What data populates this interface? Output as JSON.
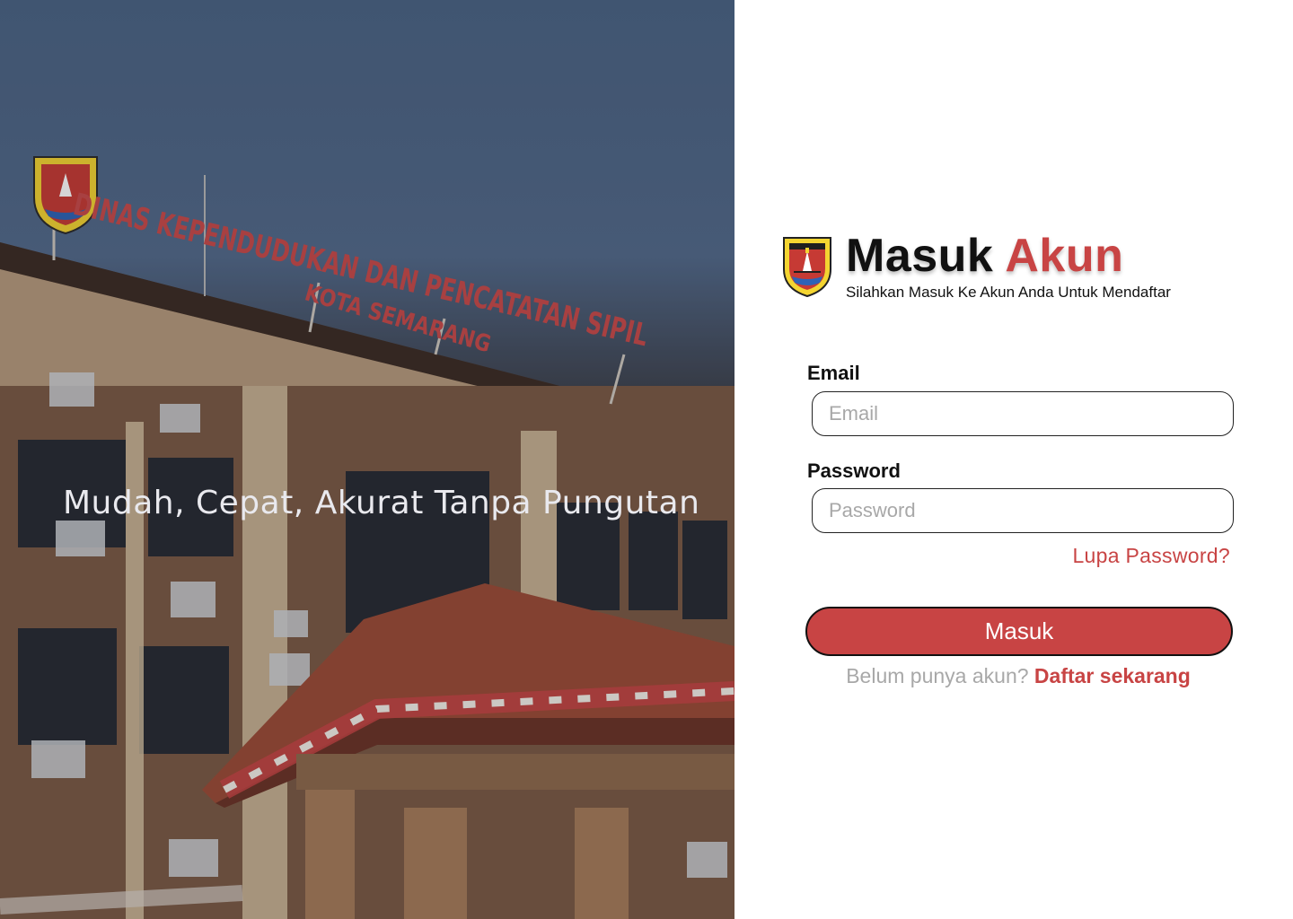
{
  "hero": {
    "tagline": "Mudah, Cepat, Akurat Tanpa Pungutan",
    "sign_line1": "DINAS KEPENDUDUKAN DAN PENCATATAN SIPIL",
    "sign_line2": "KOTA SEMARANG"
  },
  "login": {
    "title_main": "Masuk",
    "title_accent": "Akun",
    "subtitle": "Silahkan Masuk Ke Akun Anda Untuk Mendaftar",
    "email_label": "Email",
    "email_placeholder": "Email",
    "password_label": "Password",
    "password_placeholder": "Password",
    "forgot_label": "Lupa Password?",
    "submit_label": "Masuk",
    "register_prompt": "Belum punya akun?",
    "register_link": "Daftar sekarang"
  },
  "colors": {
    "accent": "#c84444",
    "text": "#111111",
    "muted": "#a8a8a8"
  },
  "icons": {
    "logo": "semarang-city-crest-icon"
  }
}
